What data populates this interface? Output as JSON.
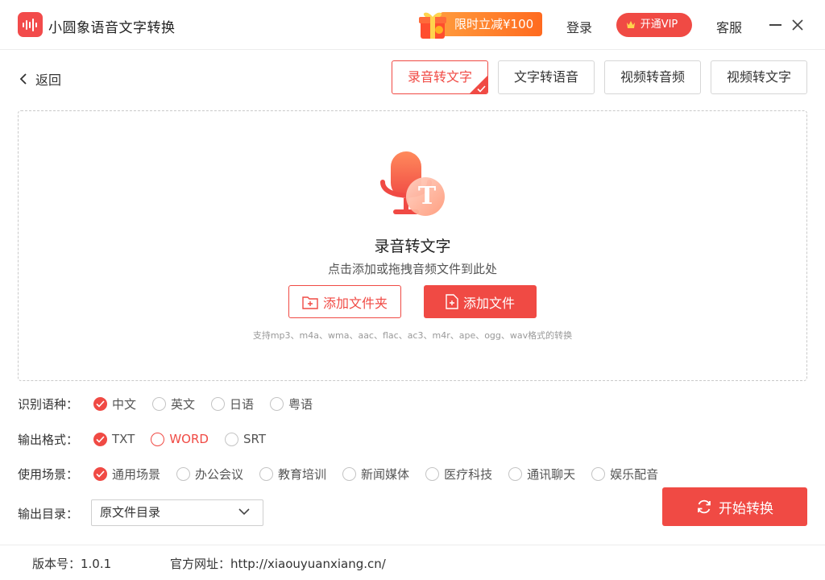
{
  "app": {
    "title": "小圆象语音文字转换"
  },
  "header": {
    "promo_label": "限时立减¥100",
    "login_label": "登录",
    "vip_label": "开通VIP",
    "service_label": "客服"
  },
  "nav": {
    "back_label": "返回",
    "tabs": [
      {
        "label": "录音转文字",
        "active": true
      },
      {
        "label": "文字转语音"
      },
      {
        "label": "视频转音频"
      },
      {
        "label": "视频转文字"
      }
    ]
  },
  "dropzone": {
    "title": "录音转文字",
    "subtitle": "点击添加或拖拽音频文件到此处",
    "add_folder_label": "添加文件夹",
    "add_file_label": "添加文件",
    "formats_note": "支持mp3、m4a、wma、aac、flac、ac3、m4r、ape、ogg、wav格式的转换",
    "icon_letter": "T"
  },
  "options": {
    "language": {
      "label": "识别语种：",
      "choices": [
        "中文",
        "英文",
        "日语",
        "粤语"
      ],
      "selected": "中文"
    },
    "format": {
      "label": "输出格式：",
      "choices": [
        "TXT",
        "WORD",
        "SRT"
      ],
      "selected": "TXT"
    },
    "scene": {
      "label": "使用场景：",
      "choices": [
        "通用场景",
        "办公会议",
        "教育培训",
        "新闻媒体",
        "医疗科技",
        "通讯聊天",
        "娱乐配音"
      ],
      "selected": "通用场景"
    },
    "output_dir": {
      "label": "输出目录：",
      "value": "原文件目录"
    }
  },
  "actions": {
    "start_label": "开始转换"
  },
  "footer": {
    "version_label": "版本号：1.0.1",
    "site_label": "官方网址：http://xiaouyuanxiang.cn/"
  },
  "colors": {
    "accent": "#f04a44",
    "promo": "#ff7a2a"
  }
}
